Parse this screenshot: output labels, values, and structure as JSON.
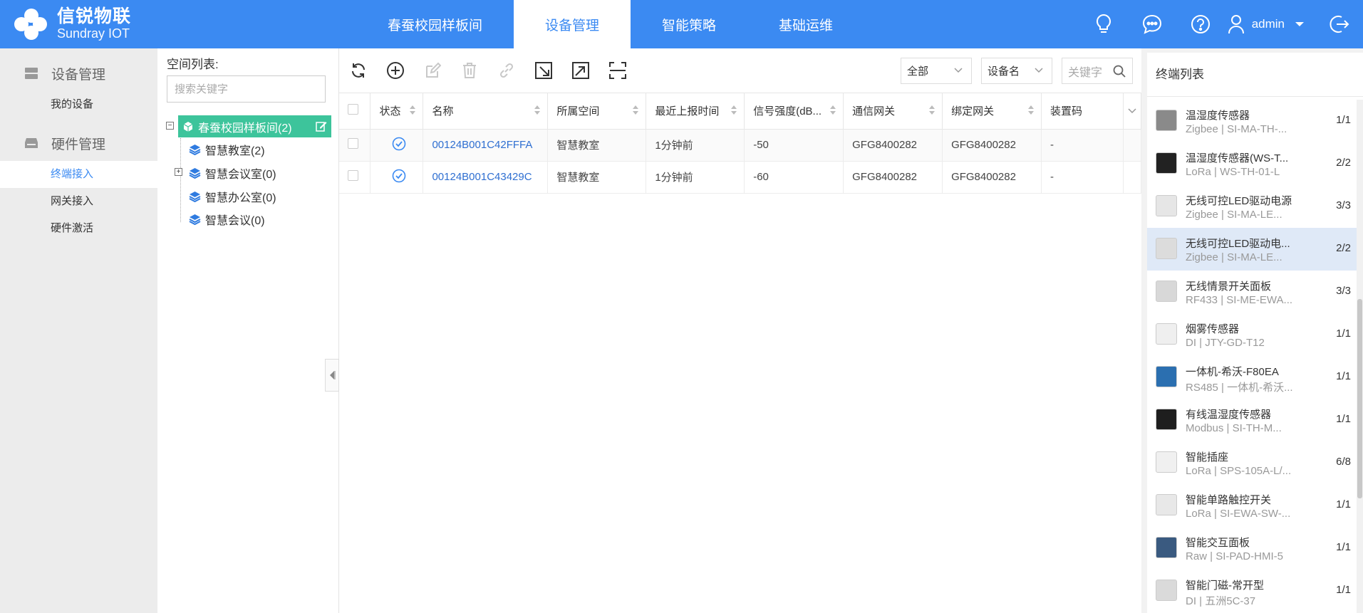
{
  "brand": {
    "name_cn": "信锐物联",
    "name_en": "Sundray IOT"
  },
  "nav": [
    {
      "label": "春蚕校园样板间",
      "active": false
    },
    {
      "label": "设备管理",
      "active": true
    },
    {
      "label": "智能策略",
      "active": false
    },
    {
      "label": "基础运维",
      "active": false
    }
  ],
  "user": {
    "name": "admin"
  },
  "icons": {
    "bulb": "lightbulb-icon",
    "chat": "chat-icon",
    "help": "help-icon",
    "user": "user-icon",
    "logout": "logout-icon"
  },
  "sidebar": {
    "groups": [
      {
        "label": "设备管理",
        "items": [
          {
            "label": "我的设备",
            "active": false
          }
        ]
      },
      {
        "label": "硬件管理",
        "items": [
          {
            "label": "终端接入",
            "active": true
          },
          {
            "label": "网关接入",
            "active": false
          },
          {
            "label": "硬件激活",
            "active": false
          }
        ]
      }
    ]
  },
  "tree": {
    "title": "空间列表:",
    "search_placeholder": "搜索关键字",
    "root": "春蚕校园样板间(2)",
    "children": [
      "智慧教室(2)",
      "智慧会议室(0)",
      "智慧办公室(0)",
      "智慧会议(0)"
    ]
  },
  "toolbar": {
    "filter_scope": "全部",
    "filter_field": "设备名",
    "search_placeholder": "关键字"
  },
  "table": {
    "columns": [
      "状态",
      "名称",
      "所属空间",
      "最近上报时间",
      "信号强度(dB...",
      "通信网关",
      "绑定网关",
      "装置码"
    ],
    "rows": [
      {
        "name": "00124B001C42FFFA",
        "space": "智慧教室",
        "last_report": "1分钟前",
        "signal": "-50",
        "comm_gateway": "GFG8400282",
        "bind_gateway": "GFG8400282",
        "code": "-"
      },
      {
        "name": "00124B001C43429C",
        "space": "智慧教室",
        "last_report": "1分钟前",
        "signal": "-60",
        "comm_gateway": "GFG8400282",
        "bind_gateway": "GFG8400282",
        "code": "-"
      }
    ]
  },
  "terminals": {
    "title": "终端列表",
    "items": [
      {
        "name": "温湿度传感器",
        "sub": "Zigbee | SI-MA-TH-...",
        "count": "1/1",
        "thumb": "#8a8a8a"
      },
      {
        "name": "温湿度传感器(WS-T...",
        "sub": "LoRa | WS-TH-01-L",
        "count": "2/2",
        "thumb": "#222222"
      },
      {
        "name": "无线可控LED驱动电源",
        "sub": "Zigbee | SI-MA-LE...",
        "count": "3/3",
        "thumb": "#e6e6e6"
      },
      {
        "name": "无线可控LED驱动电...",
        "sub": "Zigbee | SI-MA-LE...",
        "count": "2/2",
        "thumb": "#dcdcdc",
        "active": true
      },
      {
        "name": "无线情景开关面板",
        "sub": "RF433 | SI-ME-EWA...",
        "count": "3/3",
        "thumb": "#d8d8d8"
      },
      {
        "name": "烟雾传感器",
        "sub": "DI | JTY-GD-T12",
        "count": "1/1",
        "thumb": "#efefef"
      },
      {
        "name": "一体机-希沃-F80EA",
        "sub": "RS485 | 一体机-希沃...",
        "count": "1/1",
        "thumb": "#2b6fb0"
      },
      {
        "name": "有线温湿度传感器",
        "sub": "Modbus | SI-TH-M...",
        "count": "1/1",
        "thumb": "#1e1e1e"
      },
      {
        "name": "智能插座",
        "sub": "LoRa | SPS-105A-L/...",
        "count": "6/8",
        "thumb": "#f0f0f0"
      },
      {
        "name": "智能单路触控开关",
        "sub": "LoRa | SI-EWA-SW-...",
        "count": "1/1",
        "thumb": "#e8e8e8"
      },
      {
        "name": "智能交互面板",
        "sub": "Raw | SI-PAD-HMI-5",
        "count": "1/1",
        "thumb": "#3a5a80"
      },
      {
        "name": "智能门磁-常开型",
        "sub": "DI | 五洲5C-37",
        "count": "1/1",
        "thumb": "#dadada"
      }
    ]
  },
  "colors": {
    "primary": "#3b8af2",
    "tree_root": "#3dc49b",
    "link": "#2f6fd1"
  }
}
